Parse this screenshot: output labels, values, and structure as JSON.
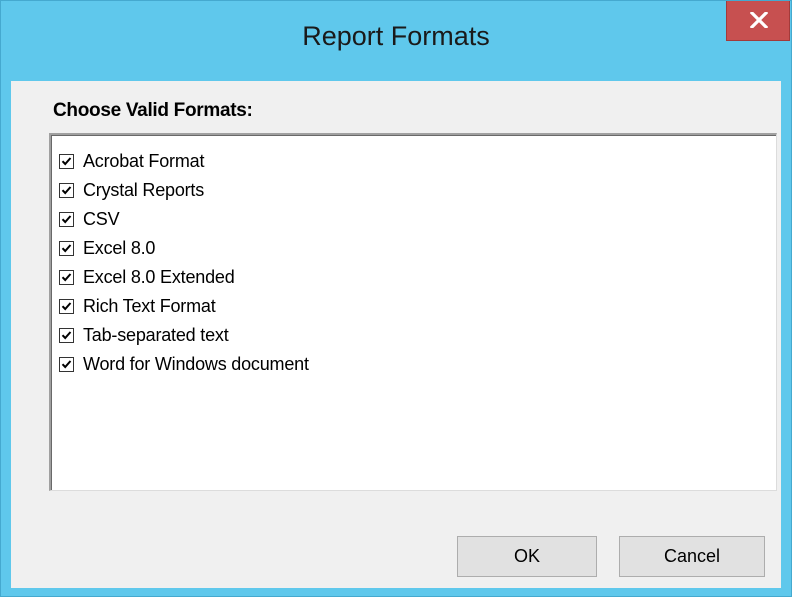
{
  "window": {
    "title": "Report Formats"
  },
  "group": {
    "label": "Choose Valid Formats:"
  },
  "formats": [
    {
      "label": "Acrobat Format",
      "checked": true
    },
    {
      "label": "Crystal Reports",
      "checked": true
    },
    {
      "label": "CSV",
      "checked": true
    },
    {
      "label": "Excel 8.0",
      "checked": true
    },
    {
      "label": "Excel 8.0 Extended",
      "checked": true
    },
    {
      "label": "Rich Text Format",
      "checked": true
    },
    {
      "label": "Tab-separated text",
      "checked": true
    },
    {
      "label": "Word for Windows document",
      "checked": true
    }
  ],
  "buttons": {
    "ok": "OK",
    "cancel": "Cancel"
  },
  "colors": {
    "titlebar": "#5fc8ec",
    "close": "#c75050",
    "client": "#f0f0f0"
  },
  "icons": {
    "close": "close-icon",
    "check": "checkmark-icon"
  }
}
